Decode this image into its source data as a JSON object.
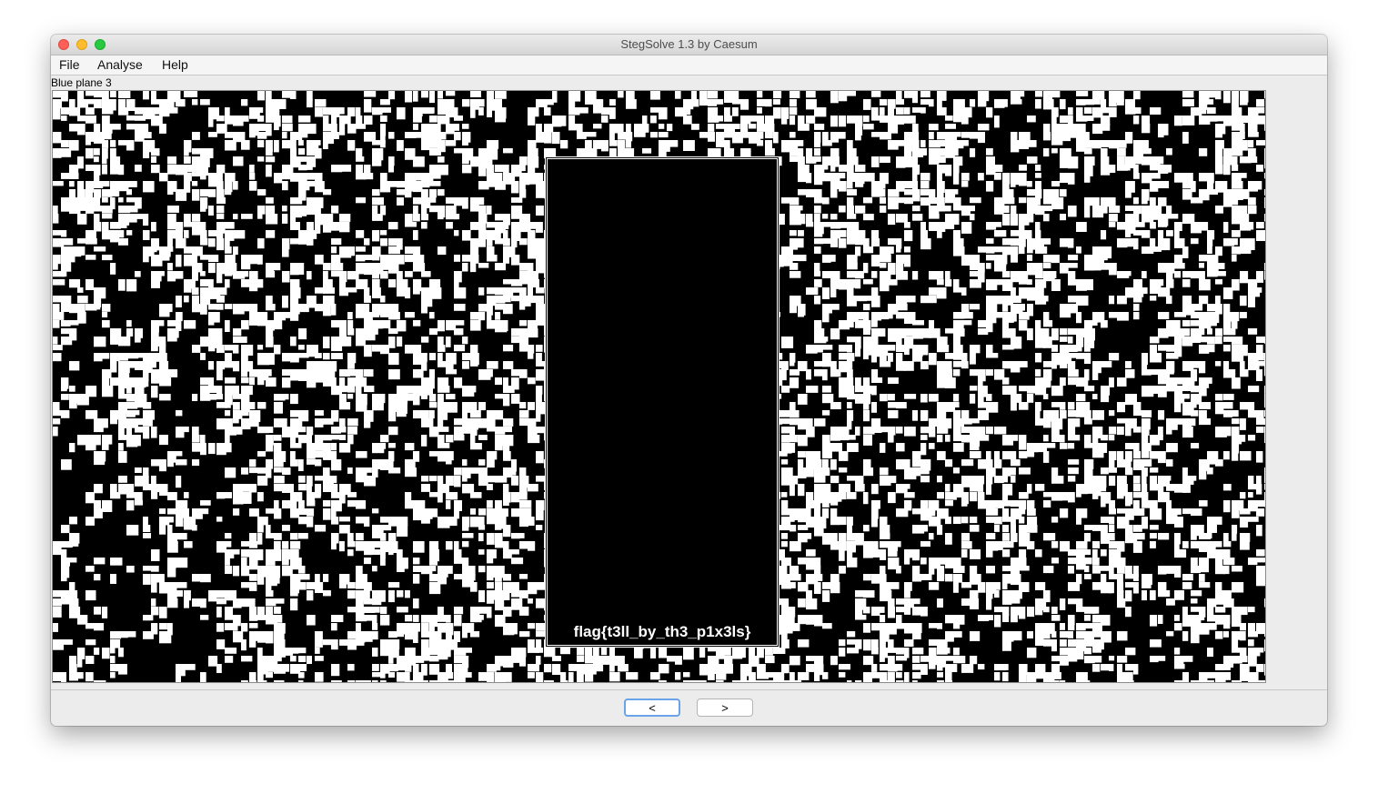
{
  "window": {
    "title": "StegSolve 1.3 by Caesum"
  },
  "menu": {
    "file": "File",
    "analyse": "Analyse",
    "help": "Help"
  },
  "view": {
    "plane_label": "Blue plane 3",
    "flag_text": "flag{t3ll_by_th3_p1x3ls}"
  },
  "nav": {
    "prev": "<",
    "next": ">"
  }
}
